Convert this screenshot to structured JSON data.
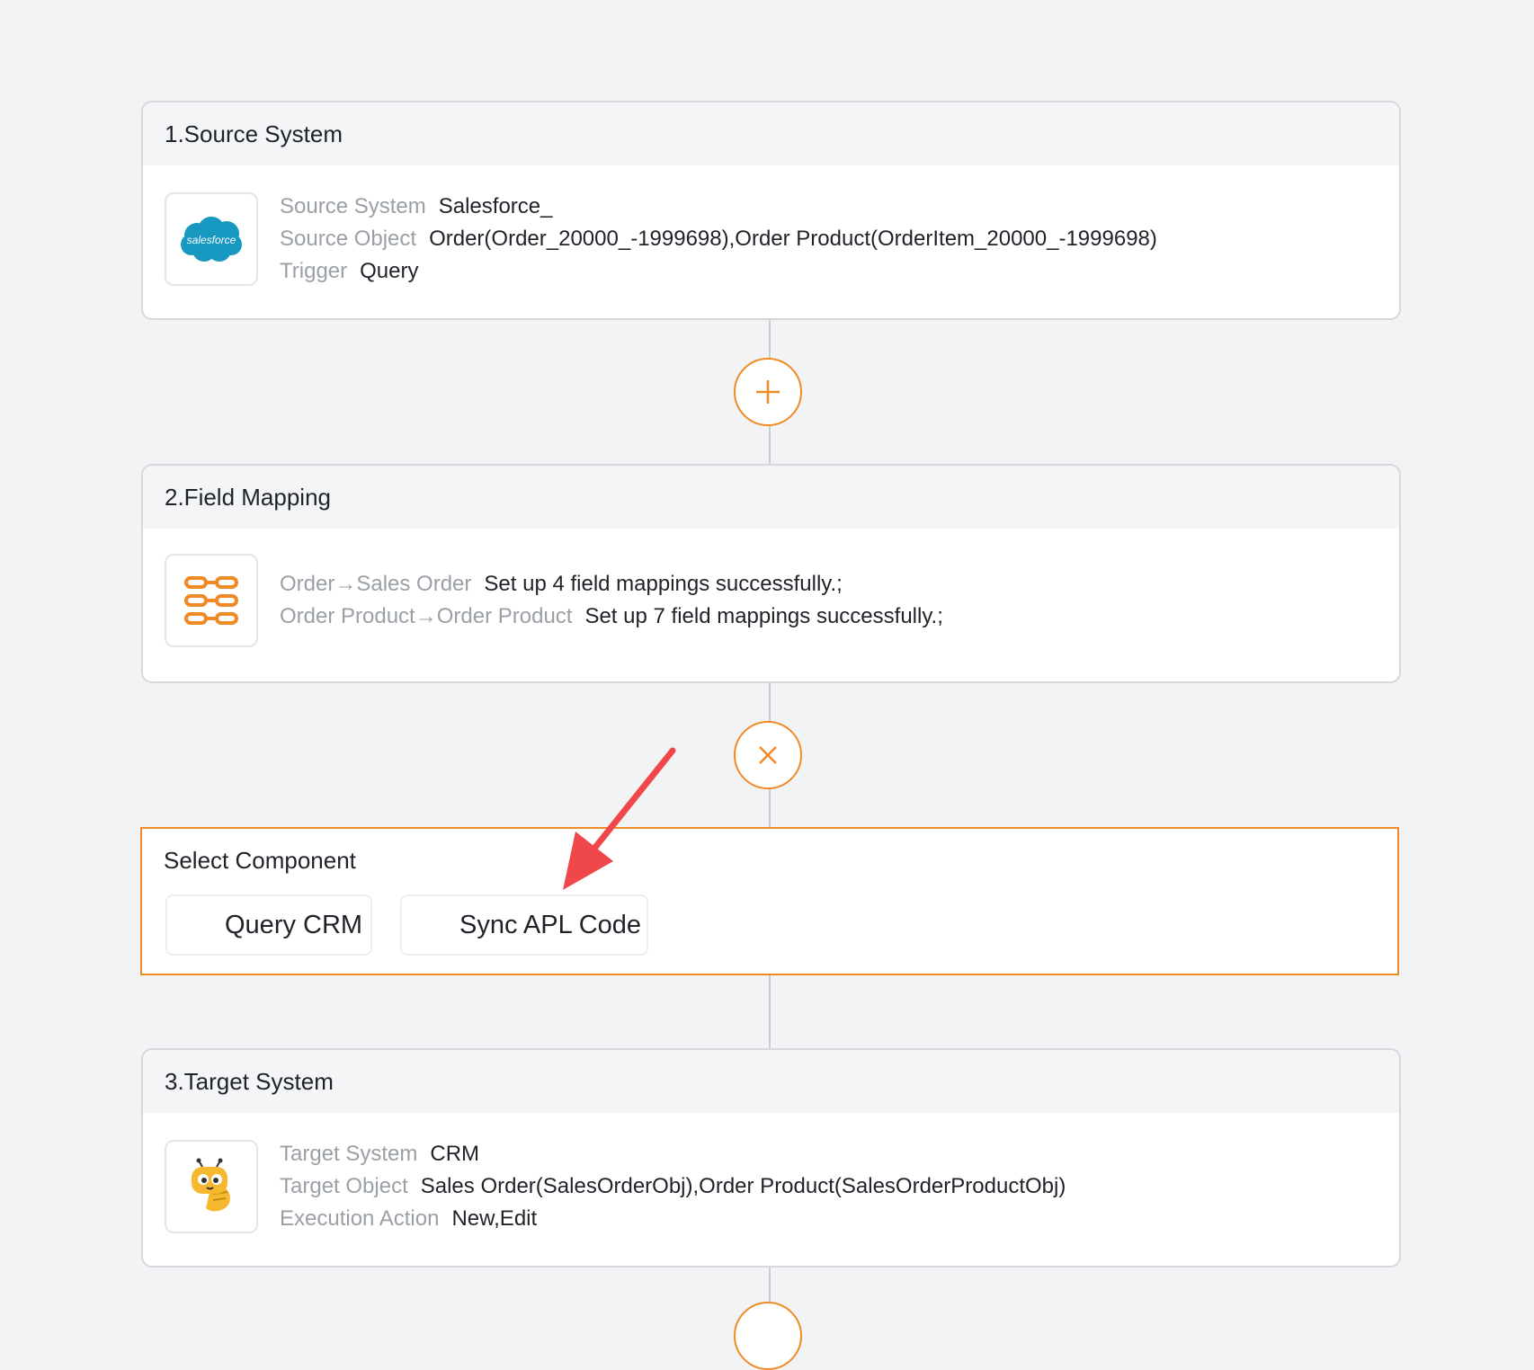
{
  "source_card": {
    "title": "1.Source System",
    "icon_text": "salesforce",
    "rows": [
      {
        "label": "Source System",
        "value": "Salesforce_"
      },
      {
        "label": "Source Object",
        "value": "Order(Order_20000_-1999698),Order Product(OrderItem_20000_-1999698)"
      },
      {
        "label": "Trigger",
        "value": "Query"
      }
    ]
  },
  "mapping_card": {
    "title": "2.Field Mapping",
    "rows": [
      {
        "label": "Order→Sales Order",
        "value": "Set up 4 field mappings successfully.;"
      },
      {
        "label": "Order Product→Order Product",
        "value": "Set up 7 field mappings successfully.;"
      }
    ]
  },
  "select_component": {
    "title": "Select Component",
    "options": [
      "Query CRM",
      "Sync APL Code"
    ]
  },
  "target_card": {
    "title": "3.Target System",
    "rows": [
      {
        "label": "Target System",
        "value": "CRM"
      },
      {
        "label": "Target Object",
        "value": "Sales Order(SalesOrderObj),Order Product(SalesOrderProductObj)"
      },
      {
        "label": "Execution Action",
        "value": "New,Edit"
      }
    ]
  },
  "icons": {
    "add": "plus-icon",
    "close": "close-icon",
    "source_logo": "salesforce-logo-icon",
    "mapping": "field-mapping-icon",
    "target_logo": "crm-mascot-icon"
  },
  "colors": {
    "accent": "#f08a24",
    "salesforce_blue": "#1798c1",
    "arrow": "#f0484a"
  }
}
